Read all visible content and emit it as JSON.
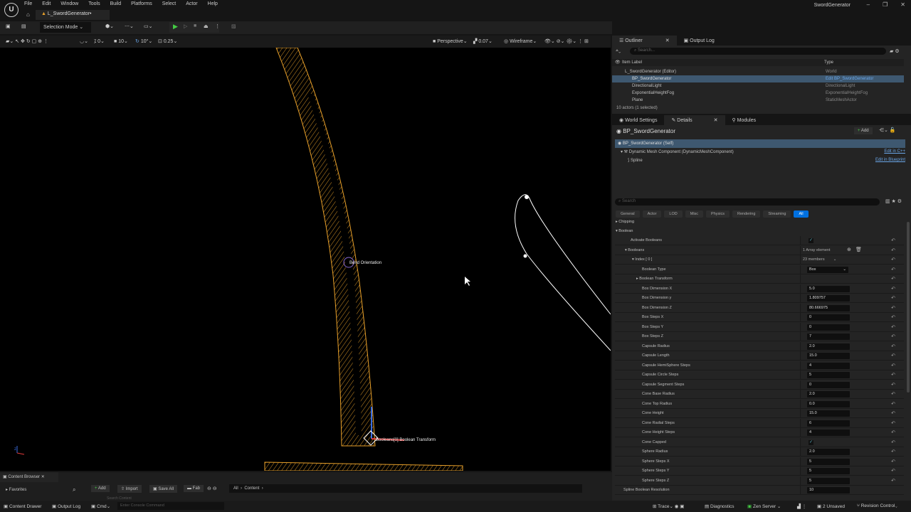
{
  "menu": [
    "File",
    "Edit",
    "Window",
    "Tools",
    "Build",
    "Platforms",
    "Select",
    "Actor",
    "Help"
  ],
  "level_tab": "L_SwordGenerator•",
  "window_title": "SwordGenerator",
  "toolbar": {
    "selection_mode": "Selection Mode"
  },
  "viewport_toolbar": {
    "snap_translate": "0",
    "snap_grid": "10",
    "snap_rot": "10°",
    "snap_scale": "0.25",
    "perspective": "Perspective",
    "camera_speed": "0.07",
    "view_mode": "Wireframe"
  },
  "viewport": {
    "label_bend": "Bend Orientation",
    "label_transform": "Booleans[0] Boolean Transform",
    "colors": {
      "wire": "#e8a02a",
      "spline": "#ffffff"
    }
  },
  "outliner": {
    "tab": "Outliner",
    "tab2": "Output Log",
    "search_placeholder": "Search...",
    "col_label": "Item Label",
    "col_type": "Type",
    "rows": [
      {
        "label": "L_SwordGenerator (Editor)",
        "type": "World"
      },
      {
        "label": "BP_SwordGenerator",
        "type": "Edit BP_SwordGenerator"
      },
      {
        "label": "DirectionalLight",
        "type": "DirectionalLight"
      },
      {
        "label": "ExponentialHeightFog",
        "type": "ExponentialHeightFog"
      },
      {
        "label": "Plane",
        "type": "StaticMeshActor"
      }
    ],
    "footer": "10 actors (1 selected)"
  },
  "details": {
    "tab_world": "World Settings",
    "tab_details": "Details",
    "tab_modules": "Modules",
    "title": "BP_SwordGenerator",
    "add": "Add",
    "self": "BP_SwordGenerator (Self)",
    "comp": "Dynamic Mesh Component (DynamicMeshComponent)",
    "edit_cpp": "Edit in C++",
    "spline": "Spline",
    "edit_bp": "Edit in Blueprint",
    "search_placeholder": "Search",
    "filters": [
      "General",
      "Actor",
      "LOD",
      "Misc",
      "Physics",
      "Rendering",
      "Streaming",
      "All"
    ],
    "sections": {
      "chipping": "Chipping",
      "boolean": "Boolean"
    },
    "props": [
      {
        "label": "Activate Booleans",
        "kind": "check",
        "value": "✓",
        "indent": 1
      },
      {
        "label": "Booleans",
        "kind": "text",
        "value": "1 Array element",
        "indent": 1
      },
      {
        "label": "Index [ 0 ]",
        "kind": "text",
        "value": "23 members",
        "indent": 2
      },
      {
        "label": "Boolean Type",
        "kind": "select",
        "value": "Box",
        "indent": 3
      },
      {
        "label": "Boolean Transform",
        "kind": "none",
        "value": "",
        "indent": 3
      },
      {
        "label": "Box Dimension X",
        "kind": "input",
        "value": "5.0",
        "indent": 3
      },
      {
        "label": "Box Dimension y",
        "kind": "input",
        "value": "1.809757",
        "indent": 3
      },
      {
        "label": "Box Dimension Z",
        "kind": "input",
        "value": "80.666975",
        "indent": 3
      },
      {
        "label": "Box Steps X",
        "kind": "input",
        "value": "0",
        "indent": 3
      },
      {
        "label": "Box Steps Y",
        "kind": "input",
        "value": "0",
        "indent": 3
      },
      {
        "label": "Box Steps Z",
        "kind": "input",
        "value": "7",
        "indent": 3
      },
      {
        "label": "Capsule Radius",
        "kind": "input",
        "value": "2.0",
        "indent": 3
      },
      {
        "label": "Capsule Length",
        "kind": "input",
        "value": "15.0",
        "indent": 3
      },
      {
        "label": "Capsule HemiSphere Steps",
        "kind": "input",
        "value": "4",
        "indent": 3
      },
      {
        "label": "Capsule Circle Steps",
        "kind": "input",
        "value": "5",
        "indent": 3
      },
      {
        "label": "Capsule Segment Steps",
        "kind": "input",
        "value": "0",
        "indent": 3
      },
      {
        "label": "Cone Base Radius",
        "kind": "input",
        "value": "2.0",
        "indent": 3
      },
      {
        "label": "Cone Top Radius",
        "kind": "input",
        "value": "0.0",
        "indent": 3
      },
      {
        "label": "Cone Height",
        "kind": "input",
        "value": "15.0",
        "indent": 3
      },
      {
        "label": "Cone Radial Steps",
        "kind": "input",
        "value": "6",
        "indent": 3
      },
      {
        "label": "Cone Height Steps",
        "kind": "input",
        "value": "4",
        "indent": 3
      },
      {
        "label": "Cone Capped",
        "kind": "check",
        "value": "✓",
        "indent": 3
      },
      {
        "label": "Sphere Radius",
        "kind": "input",
        "value": "2.0",
        "indent": 3
      },
      {
        "label": "Sphere Steps X",
        "kind": "input",
        "value": "5",
        "indent": 3
      },
      {
        "label": "Sphere Steps Y",
        "kind": "input",
        "value": "5",
        "indent": 3
      },
      {
        "label": "Sphere Steps Z",
        "kind": "input",
        "value": "5",
        "indent": 3
      },
      {
        "label": "Spline Boolean Resolution",
        "kind": "input",
        "value": "10",
        "indent": 0
      }
    ]
  },
  "content_browser": {
    "tab": "Content Browser",
    "favorites": "Favorites",
    "add": "Add",
    "import": "Import",
    "save_all": "Save All",
    "fab": "Fab",
    "crumbs": [
      "All",
      "Content"
    ],
    "search_placeholder": "Search Content"
  },
  "statusbar": {
    "content_drawer": "Content Drawer",
    "output_log": "Output Log",
    "cmd": "Cmd",
    "console_placeholder": "Enter Console Command",
    "trace": "Trace",
    "diagnostics": "Diagnostics",
    "zen": "Zen Server",
    "unsaved": "2 Unsaved",
    "revision": "Revision Control"
  }
}
